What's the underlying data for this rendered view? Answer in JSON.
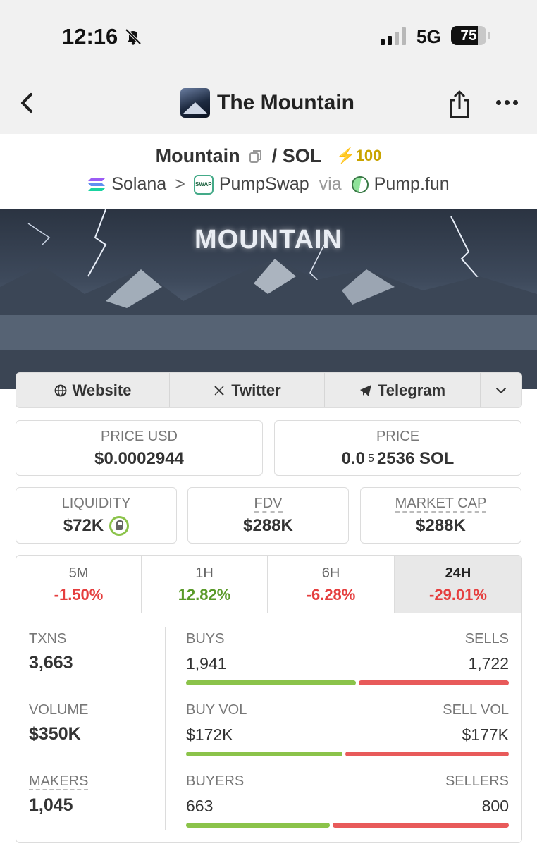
{
  "status_bar": {
    "time": "12:16",
    "network": "5G",
    "battery": "75",
    "battery_level": 0.75
  },
  "nav": {
    "title": "The Mountain",
    "back_icon": "chevron-left-icon",
    "share_icon": "share-icon",
    "more_icon": "more-dots-icon"
  },
  "pair": {
    "base": "Mountain",
    "separator": "/",
    "quote": "SOL",
    "boost": "⚡100"
  },
  "breadcrumb": {
    "chain": "Solana",
    "arrow": ">",
    "dex": "PumpSwap",
    "via": "via",
    "launchpad": "Pump.fun"
  },
  "banner": {
    "title": "MOUNTAIN"
  },
  "links": {
    "website": "Website",
    "twitter": "Twitter",
    "telegram": "Telegram"
  },
  "cards": {
    "price_usd": {
      "label": "PRICE USD",
      "value": "$0.0002944"
    },
    "price": {
      "label": "PRICE",
      "prefix": "0.0",
      "sub": "5",
      "value": "2536 SOL"
    },
    "liquidity": {
      "label": "LIQUIDITY",
      "value": "$72K"
    },
    "fdv": {
      "label": "FDV",
      "value": "$288K"
    },
    "market_cap": {
      "label": "MARKET CAP",
      "value": "$288K"
    }
  },
  "timeframes": [
    {
      "label": "5M",
      "change": "-1.50%",
      "direction": "down"
    },
    {
      "label": "1H",
      "change": "12.82%",
      "direction": "up"
    },
    {
      "label": "6H",
      "change": "-6.28%",
      "direction": "down"
    },
    {
      "label": "24H",
      "change": "-29.01%",
      "direction": "down",
      "active": true
    }
  ],
  "stats": {
    "txns": {
      "label": "TXNS",
      "value": "3,663"
    },
    "volume": {
      "label": "VOLUME",
      "value": "$350K"
    },
    "makers": {
      "label": "MAKERS",
      "value": "1,045"
    },
    "buys": {
      "left_label": "BUYS",
      "right_label": "SELLS",
      "left_value": "1,941",
      "right_value": "1,722",
      "left_share": 0.53
    },
    "vol": {
      "left_label": "BUY VOL",
      "right_label": "SELL VOL",
      "left_value": "$172K",
      "right_value": "$177K",
      "left_share": 0.49
    },
    "buyers": {
      "left_label": "BUYERS",
      "right_label": "SELLERS",
      "left_value": "663",
      "right_value": "800",
      "left_share": 0.45
    }
  },
  "colors": {
    "positive": "#5a9a2a",
    "negative": "#e53e3e",
    "bar_green": "#8bc34a",
    "bar_red": "#e85a5a",
    "boost": "#c9a400"
  }
}
